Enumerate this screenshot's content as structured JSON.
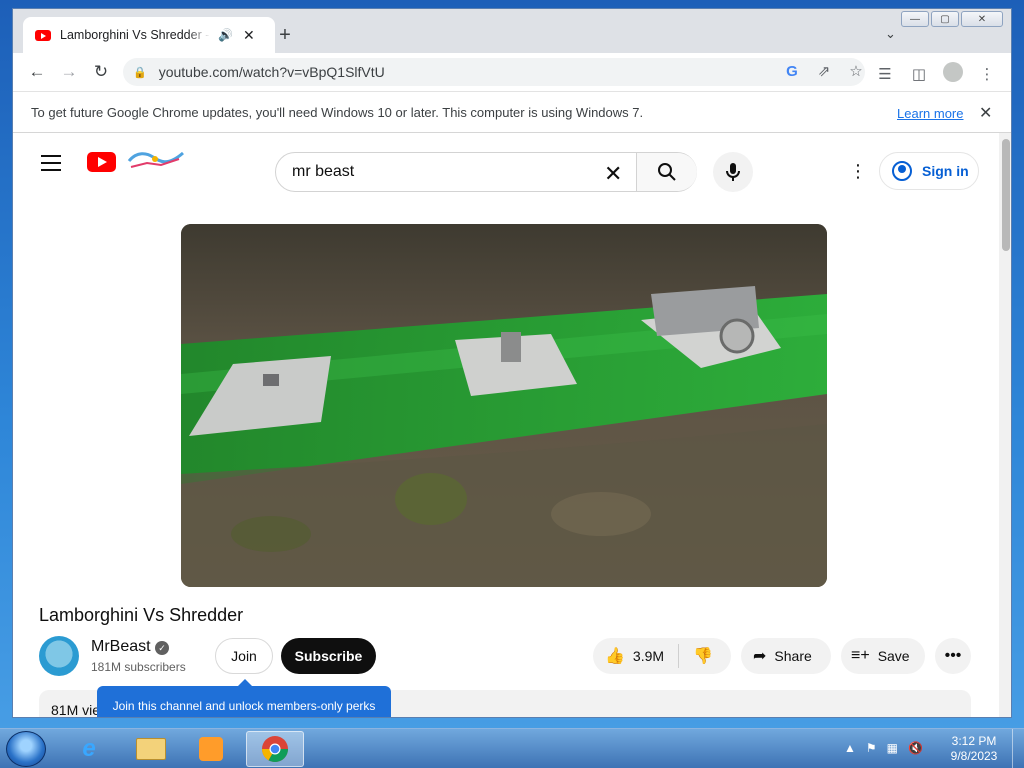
{
  "browser": {
    "tab_title": "Lamborghini Vs Shredder - YouTube",
    "url": "youtube.com/watch?v=vBpQ1SlfVtU",
    "window_controls": {
      "minimize": "—",
      "maximize": "▢",
      "close": "✕"
    }
  },
  "infobar": {
    "message": "To get future Google Chrome updates, you'll need Windows 10 or later. This computer is using Windows 7.",
    "learn_more": "Learn more"
  },
  "youtube": {
    "search": {
      "value": "mr beast",
      "placeholder": "Search"
    },
    "sign_in": "Sign in",
    "video": {
      "title": "Lamborghini Vs Shredder",
      "channel": "MrBeast",
      "subscribers": "181M subscribers",
      "join_label": "Join",
      "subscribe_label": "Subscribe",
      "likes": "3.9M",
      "share_label": "Share",
      "save_label": "Save",
      "views_truncated": "81M vie",
      "tooltip": "Join this channel and unlock members-only perks"
    }
  },
  "taskbar": {
    "time": "3:12 PM",
    "date": "9/8/2023",
    "pinned": [
      "Internet Explorer",
      "Windows Explorer",
      "Windows Media Player",
      "Google Chrome"
    ]
  },
  "colors": {
    "youtube_red": "#ff0000",
    "link_blue": "#065fd4",
    "tooltip_blue": "#1f70d8",
    "subscribe_black": "#0f0f0f"
  }
}
